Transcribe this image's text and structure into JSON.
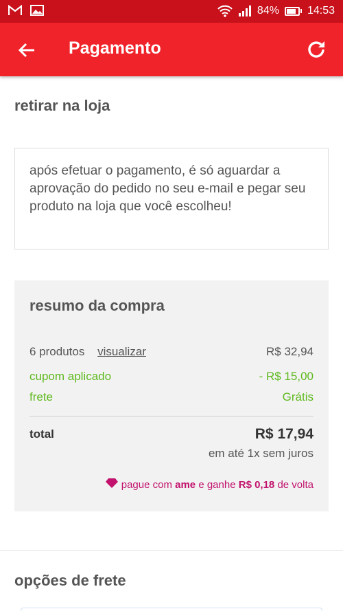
{
  "status_bar": {
    "battery": "84%",
    "battery_level": 0.84,
    "time": "14:53"
  },
  "app_bar": {
    "title": "Pagamento"
  },
  "pickup": {
    "title": "retirar na loja",
    "info": "após efetuar o pagamento, é só aguardar a aprovação do pedido no seu e-mail e pegar seu produto na loja que você escolheu!"
  },
  "summary": {
    "title": "resumo da compra",
    "products_label": "6 produtos",
    "products_link": "visualizar",
    "products_value": "R$ 32,94",
    "coupon_label": "cupom aplicado",
    "coupon_value": "- R$ 15,00",
    "shipping_label": "frete",
    "shipping_value": "Grátis",
    "total_label": "total",
    "total_value": "R$ 17,94",
    "installments": "em até 1x sem juros",
    "ame": {
      "prefix": "pague com",
      "brand": "ame",
      "middle": "e ganhe",
      "cashback": "R$ 0,18",
      "suffix": "de volta"
    }
  },
  "shipping_options": {
    "title": "opções de frete"
  },
  "colors": {
    "status_bar": "#c8111b",
    "app_bar": "#f0232a",
    "discount_green": "#5fb91e",
    "ame_pink": "#c2126d"
  }
}
